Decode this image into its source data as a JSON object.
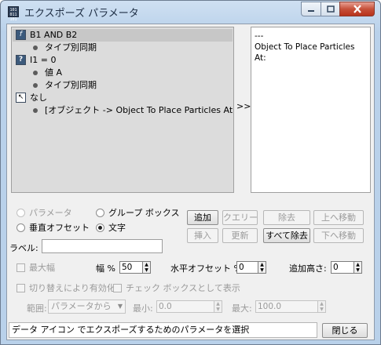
{
  "window": {
    "title": "エクスポーズ パラメータ",
    "icon_text": "1001 0110 1001"
  },
  "tree": {
    "items": [
      {
        "kind": "function",
        "icon": "f",
        "label": "B1 AND B2"
      },
      {
        "kind": "child",
        "label": "タイプ別同期"
      },
      {
        "kind": "condition",
        "icon": "?",
        "label": "I1 = 0"
      },
      {
        "kind": "child",
        "label": "値 A"
      },
      {
        "kind": "child",
        "label": "タイプ別同期"
      },
      {
        "kind": "selection",
        "icon": "↖",
        "label": "なし"
      },
      {
        "kind": "child",
        "label": "[オブジェクト -> Object To Place Particles At:]"
      }
    ]
  },
  "transfer_arrows": ">>",
  "exposed": {
    "lines": [
      "---",
      "Object To Place Particles At:"
    ]
  },
  "options": {
    "parameter": "パラメータ",
    "group_box": "グループ ボックス",
    "vertical_offset": "垂直オフセット",
    "text": "文字",
    "selected": "text"
  },
  "buttons": {
    "add": "追加",
    "query": "クエリー",
    "remove": "除去",
    "move_up": "上へ移動",
    "insert": "挿入",
    "update": "更新",
    "remove_all": "すべて除去",
    "move_down": "下へ移動",
    "close": "閉じる"
  },
  "fields": {
    "label_caption": "ラベル:",
    "label_value": "",
    "max_width": "最大幅",
    "width_pct": "幅 %",
    "width_pct_value": "50",
    "h_offset_pct": "水平オフセット %",
    "h_offset_value": "0",
    "extra_height": "追加高さ:",
    "extra_height_value": "0",
    "toggle_enable": "切り替えにより有効化",
    "show_as_checkbox": "チェック ボックスとして表示",
    "range_caption": "範囲:",
    "range_value": "パラメータから",
    "min_caption": "最小:",
    "min_value": "0.0",
    "max_caption": "最大:",
    "max_value": "100.0"
  },
  "status": {
    "text": "データ アイコン  でエクスポーズするためのパラメータを選択"
  },
  "colors": {
    "titlebar": "#b9d1ea",
    "close_button": "#c6513a",
    "dialog_bg": "#f0f0f0"
  }
}
